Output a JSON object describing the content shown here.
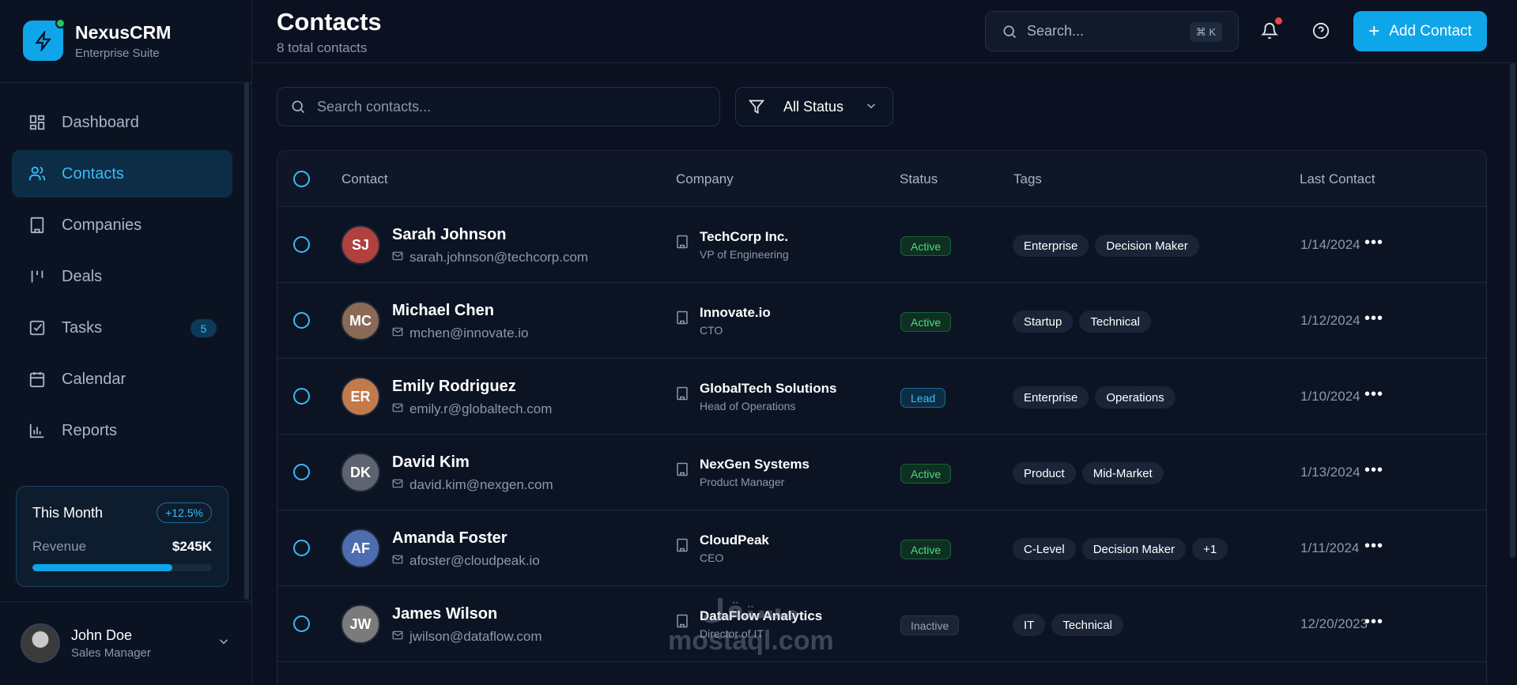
{
  "brand": {
    "name": "NexusCRM",
    "subtitle": "Enterprise Suite"
  },
  "sidebar": {
    "items": [
      {
        "label": "Dashboard",
        "icon": "dashboard-icon",
        "active": false
      },
      {
        "label": "Contacts",
        "icon": "users-icon",
        "active": true
      },
      {
        "label": "Companies",
        "icon": "building-icon",
        "active": false
      },
      {
        "label": "Deals",
        "icon": "deals-icon",
        "active": false
      },
      {
        "label": "Tasks",
        "icon": "checkbox-icon",
        "active": false,
        "badge": "5"
      },
      {
        "label": "Calendar",
        "icon": "calendar-icon",
        "active": false
      },
      {
        "label": "Reports",
        "icon": "bar-chart-icon",
        "active": false
      }
    ],
    "month_card": {
      "title": "This Month",
      "change": "+12.5%",
      "label": "Revenue",
      "value": "$245K",
      "progress": 0.78
    },
    "user": {
      "name": "John Doe",
      "role": "Sales Manager"
    }
  },
  "header": {
    "title": "Contacts",
    "subtitle": "8 total contacts",
    "search_placeholder": "Search...",
    "shortcut": "⌘ K",
    "add_button": "Add Contact"
  },
  "filters": {
    "search_placeholder": "Search contacts...",
    "status_value": "All Status"
  },
  "table": {
    "columns": [
      "Contact",
      "Company",
      "Status",
      "Tags",
      "Last Contact"
    ],
    "rows": [
      {
        "name": "Sarah Johnson",
        "email": "sarah.johnson@techcorp.com",
        "company": "TechCorp Inc.",
        "role": "VP of Engineering",
        "status": "Active",
        "tags": [
          "Enterprise",
          "Decision Maker"
        ],
        "last": "1/14/2024",
        "avatar_color": "#b0413e"
      },
      {
        "name": "Michael Chen",
        "email": "mchen@innovate.io",
        "company": "Innovate.io",
        "role": "CTO",
        "status": "Active",
        "tags": [
          "Startup",
          "Technical"
        ],
        "last": "1/12/2024",
        "avatar_color": "#8a6a55"
      },
      {
        "name": "Emily Rodriguez",
        "email": "emily.r@globaltech.com",
        "company": "GlobalTech Solutions",
        "role": "Head of Operations",
        "status": "Lead",
        "tags": [
          "Enterprise",
          "Operations"
        ],
        "last": "1/10/2024",
        "avatar_color": "#c27a4a"
      },
      {
        "name": "David Kim",
        "email": "david.kim@nexgen.com",
        "company": "NexGen Systems",
        "role": "Product Manager",
        "status": "Active",
        "tags": [
          "Product",
          "Mid-Market"
        ],
        "last": "1/13/2024",
        "avatar_color": "#5d6470"
      },
      {
        "name": "Amanda Foster",
        "email": "afoster@cloudpeak.io",
        "company": "CloudPeak",
        "role": "CEO",
        "status": "Active",
        "tags": [
          "C-Level",
          "Decision Maker",
          "+1"
        ],
        "last": "1/11/2024",
        "avatar_color": "#4d6db0"
      },
      {
        "name": "James Wilson",
        "email": "jwilson@dataflow.com",
        "company": "DataFlow Analytics",
        "role": "Director of IT",
        "status": "Inactive",
        "tags": [
          "IT",
          "Technical"
        ],
        "last": "12/20/2023",
        "avatar_color": "#7b7b7b"
      }
    ]
  },
  "watermark": {
    "line1": "مستقل",
    "line2": "mostaql.com"
  },
  "colors": {
    "accent": "#0ea5e9",
    "background": "#0b1120",
    "active_status": "#4ade80",
    "lead_status": "#38bdf8"
  }
}
